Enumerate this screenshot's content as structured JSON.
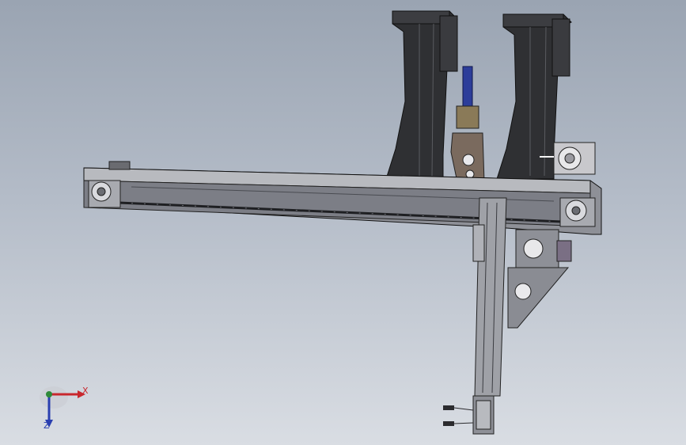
{
  "viewport": {
    "background_top": "#9aa4b2",
    "background_bottom": "#d9dde3"
  },
  "model": {
    "components": [
      "gantry-beam",
      "left-pulley",
      "right-pulley",
      "timing-belt",
      "left-tower",
      "right-tower",
      "blue-cylinder",
      "gripper-bracket",
      "right-servo-motor",
      "vertical-slide",
      "carriage-motor",
      "triangular-gusset",
      "bottom-motor",
      "cable-connectors"
    ],
    "colors": {
      "steel": "#8e9097",
      "steel_light": "#b8babf",
      "tower": "#2f3033",
      "cylinder": "#2c3d9a",
      "bracket": "#7a6a5e",
      "motor": "#c8c8cc",
      "edge": "#1a1a1a"
    }
  },
  "triad": {
    "x_label": "X",
    "z_label": "Z",
    "x_color": "#c8272d",
    "y_color": "#2f8a3a",
    "z_color": "#2a3fb0"
  }
}
